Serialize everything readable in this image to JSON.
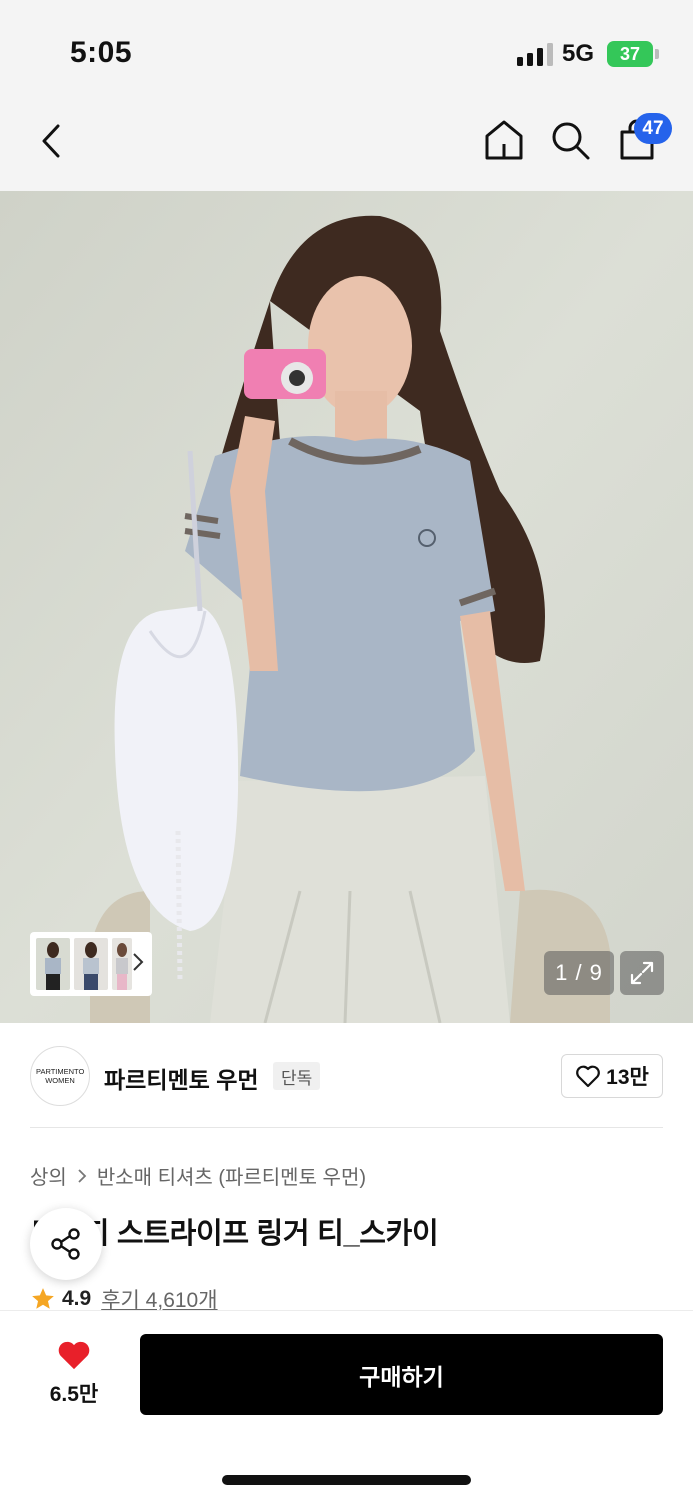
{
  "status_bar": {
    "time": "5:05",
    "network": "5G",
    "battery": "37"
  },
  "nav": {
    "cart_count": "47"
  },
  "gallery": {
    "counter": "1 / 9"
  },
  "brand": {
    "logo_text": "PARTIMENTO WOMEN",
    "name": "파르티멘토 우먼",
    "tag": "단독",
    "likes": "13만"
  },
  "breadcrumb": {
    "category": "상의",
    "subcategory": "반소매 티셔츠 (파르티멘토 우먼)"
  },
  "product": {
    "title": "트리지 스트라이프 링거 티_스카이",
    "rating": "4.9",
    "reviews": "후기 4,610개"
  },
  "bottom": {
    "wish_count": "6.5만",
    "buy_label": "구매하기"
  },
  "colors": {
    "accent_blue": "#2563eb",
    "heart_red": "#e8202a",
    "star": "#f5a623"
  }
}
